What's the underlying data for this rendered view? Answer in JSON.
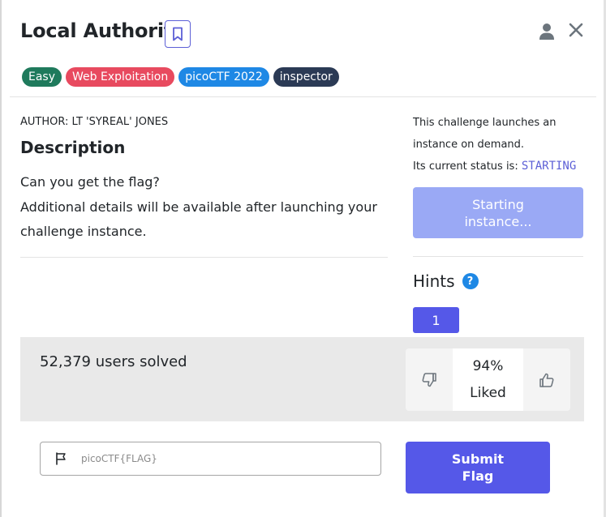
{
  "challenge": {
    "title": "Local Authority",
    "tags": [
      {
        "label": "Easy",
        "color": "#1f7a5c"
      },
      {
        "label": "Web Exploitation",
        "color": "#e84a5f"
      },
      {
        "label": "picoCTF 2022",
        "color": "#1e88e5"
      },
      {
        "label": "inspector",
        "color": "#2b3a55"
      }
    ]
  },
  "header": {
    "bookmark_icon": "bookmark-icon",
    "user_icon": "user-icon",
    "close_icon": "close-icon"
  },
  "description": {
    "author": "AUTHOR: LT 'SYREAL' JONES",
    "heading": "Description",
    "line1": "Can you get the flag?",
    "line2": "Additional details will be available after launching your challenge instance."
  },
  "instance": {
    "launch_text": "This challenge launches an instance on demand.",
    "status_label": "Its current status is:",
    "status_value": "STARTING",
    "button_label": "Starting instance..."
  },
  "hints": {
    "heading": "Hints",
    "help_icon": "question-circle-icon",
    "items": [
      "1"
    ]
  },
  "stats": {
    "solved": "52,379 users solved",
    "liked_percent": "94%",
    "liked_label": "Liked",
    "dislike_icon": "thumbs-down-icon",
    "like_icon": "thumbs-up-icon"
  },
  "flag": {
    "placeholder": "picoCTF{FLAG}",
    "value": "",
    "flag_icon": "flag-icon",
    "submit_label": "Submit Flag"
  },
  "colors": {
    "accent": "#5558e8",
    "starting_button": "#9aa9f5",
    "status_text": "#5c5fd6"
  }
}
